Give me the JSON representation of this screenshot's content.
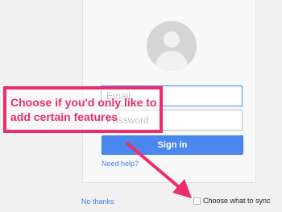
{
  "form": {
    "email_placeholder": "Email",
    "password_placeholder": "Password",
    "signin_label": "Sign in",
    "help_link": "Need help?"
  },
  "footer": {
    "no_thanks": "No thanks",
    "sync_label": "Choose what to sync"
  },
  "annotation": {
    "text": "Choose if you'd only like to add certain features",
    "color": "#ee2c6b"
  },
  "colors": {
    "accent": "#4a87ee",
    "link": "#427fed"
  }
}
